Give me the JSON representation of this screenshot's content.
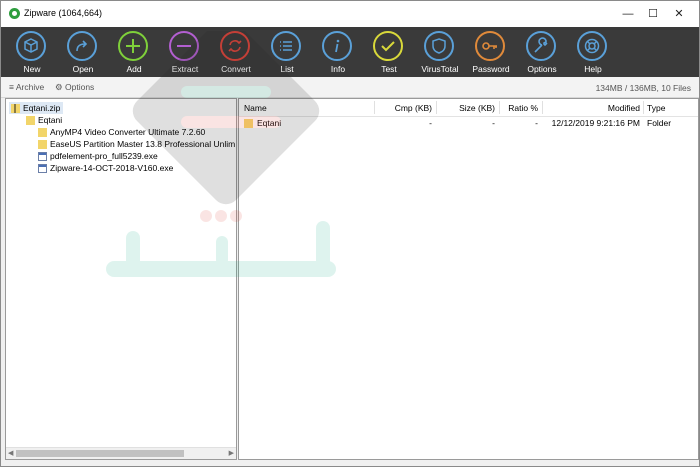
{
  "window": {
    "title": "Zipware (1064,664)"
  },
  "window_controls": {
    "minimize": "—",
    "maximize": "☐",
    "close": "✕"
  },
  "toolbar": {
    "new": "New",
    "open": "Open",
    "add": "Add",
    "extract": "Extract",
    "convert": "Convert",
    "list": "List",
    "info": "Info",
    "test": "Test",
    "virustotal": "VirusTotal",
    "password": "Password",
    "options": "Options",
    "help": "Help"
  },
  "colors": {
    "new": "#5aa0d8",
    "open": "#5aa0d8",
    "add": "#7fd03a",
    "extract": "#b35fd1",
    "convert": "#e0453b",
    "list": "#5aa0d8",
    "info": "#5aa0d8",
    "test": "#d9d93a",
    "virustotal": "#5aa0d8",
    "password": "#e08a3a",
    "options": "#5aa0d8",
    "help": "#5aa0d8"
  },
  "subbar": {
    "archive": "Archive",
    "options": "Options",
    "summary": "134MB / 136MB, 10 Files"
  },
  "tree": {
    "root": "Eqtani.zip",
    "folder": "Eqtani",
    "items": [
      "AnyMP4 Video Converter Ultimate 7.2.60",
      "EaseUS Partition Master 13.8 Professional  Unlim",
      "pdfelement-pro_full5239.exe",
      "Zipware-14-OCT-2018-V160.exe"
    ]
  },
  "list": {
    "columns": {
      "name": "Name",
      "cmp": "Cmp (KB)",
      "size": "Size (KB)",
      "ratio": "Ratio %",
      "modified": "Modified",
      "type": "Type"
    },
    "rows": [
      {
        "name": "Eqtani",
        "cmp": "-",
        "size": "-",
        "ratio": "-",
        "modified": "12/12/2019 9:21:16 PM",
        "type": "Folder"
      }
    ]
  }
}
